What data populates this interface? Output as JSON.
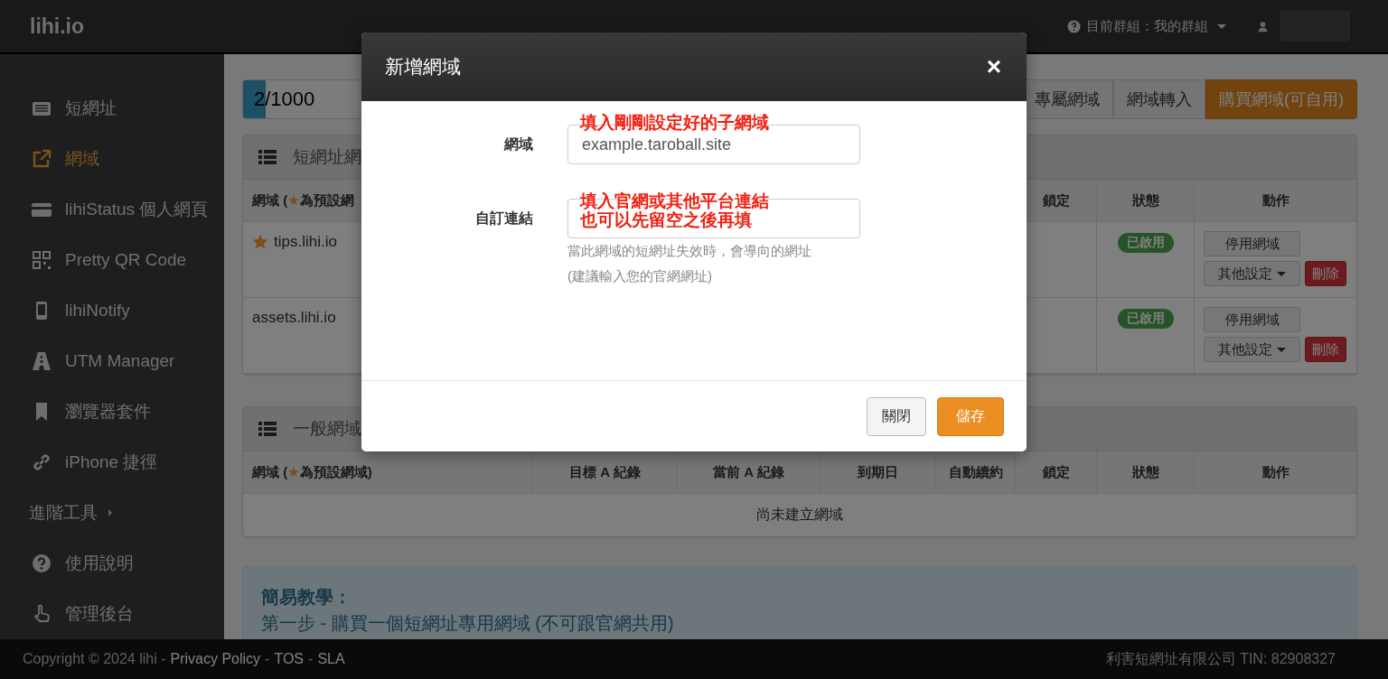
{
  "header": {
    "logo": "lihi.io",
    "group_label": "目前群組：我的群組"
  },
  "sidebar": {
    "items": [
      {
        "kind": "item",
        "label": "短網址",
        "selected": false
      },
      {
        "kind": "item",
        "label": "網域",
        "selected": true
      },
      {
        "kind": "item",
        "label": "lihiStatus 個人網頁",
        "selected": false
      },
      {
        "kind": "item",
        "label": "Pretty QR Code",
        "selected": false
      },
      {
        "kind": "item",
        "label": "lihiNotify",
        "selected": false
      },
      {
        "kind": "item",
        "label": "UTM Manager",
        "selected": false
      },
      {
        "kind": "item",
        "label": "瀏覽器套件",
        "selected": false
      },
      {
        "kind": "item",
        "label": "iPhone 捷徑",
        "selected": false
      },
      {
        "kind": "section",
        "label": "進階工具",
        "selected": false
      },
      {
        "kind": "item",
        "label": "使用說明",
        "selected": false
      },
      {
        "kind": "item",
        "label": "管理後台",
        "selected": false
      }
    ]
  },
  "usage": {
    "label": "2/1000",
    "level": 0.03
  },
  "actions": [
    {
      "label": "專屬網域",
      "kind": "default"
    },
    {
      "label": "網域轉入",
      "kind": "default"
    },
    {
      "label": "購買網域(可自用)",
      "kind": "primary"
    }
  ],
  "panels": [
    {
      "title": "短網址網",
      "columns": [
        {
          "parts": [
            {
              "text": "網域 ("
            },
            {
              "text": "★",
              "accent": true
            },
            {
              "text": "為預設網"
            }
          ]
        },
        {
          "parts": [
            {
              "text": "鎖定"
            }
          ]
        },
        {
          "parts": [
            {
              "text": "狀態"
            }
          ]
        },
        {
          "parts": [
            {
              "text": "動作"
            }
          ]
        }
      ],
      "rows": [
        {
          "domain": "tips.lihi.io",
          "default": true,
          "status": "已啟用",
          "enabled": true,
          "disable": "停用網域",
          "more": "其他設定",
          "delete": "刪除"
        },
        {
          "domain": "assets.lihi.io",
          "default": false,
          "status": "已啟用",
          "enabled": true,
          "disable": "停用網域",
          "more": "其他設定",
          "delete": "刪除"
        }
      ]
    },
    {
      "title": "一般網域",
      "columns": [
        {
          "parts": [
            {
              "text": "網域 ("
            },
            {
              "text": "★",
              "accent": true
            },
            {
              "text": "為預設網域)"
            }
          ]
        },
        {
          "parts": [
            {
              "text": "目標 A 紀錄"
            }
          ]
        },
        {
          "parts": [
            {
              "text": "當前 A 紀錄"
            }
          ]
        },
        {
          "parts": [
            {
              "text": "到期日"
            }
          ]
        },
        {
          "parts": [
            {
              "text": "自動續約"
            }
          ]
        },
        {
          "parts": [
            {
              "text": "鎖定"
            }
          ]
        },
        {
          "parts": [
            {
              "text": "狀態"
            }
          ]
        },
        {
          "parts": [
            {
              "text": "動作"
            }
          ]
        }
      ],
      "empty_text": "尚未建立網域"
    }
  ],
  "tutorial": {
    "title": "簡易教學：",
    "steps": [
      "第一步 - 購買一個短網址專用網域 (不可跟官網共用)"
    ]
  },
  "footer": {
    "left": [
      {
        "kind": "text",
        "text": "Copyright © 2024 lihi -"
      },
      {
        "kind": "link",
        "text": "Privacy Policy"
      },
      {
        "kind": "text",
        "text": "-"
      },
      {
        "kind": "link",
        "text": "TOS"
      },
      {
        "kind": "text",
        "text": "-"
      },
      {
        "kind": "link",
        "text": "SLA"
      }
    ],
    "right": "利害短網址有限公司 TIN: 82908327"
  },
  "modal": {
    "title": "新增網域",
    "close": "×",
    "fields": [
      {
        "label": "網域",
        "value": "example.taroball.site",
        "notes": [
          "填入剛剛設定好的子網域"
        ]
      },
      {
        "label": "自訂連結",
        "notes": [
          "填入官網或其他平台連結",
          "也可以先留空之後再填"
        ],
        "help": [
          "當此網域的短網址失效時，會導向的網址",
          "(建議輸入您的官網網址)"
        ]
      }
    ],
    "buttons": [
      {
        "label": "關閉",
        "kind": "default"
      },
      {
        "label": "儲存",
        "kind": "primary"
      }
    ]
  }
}
